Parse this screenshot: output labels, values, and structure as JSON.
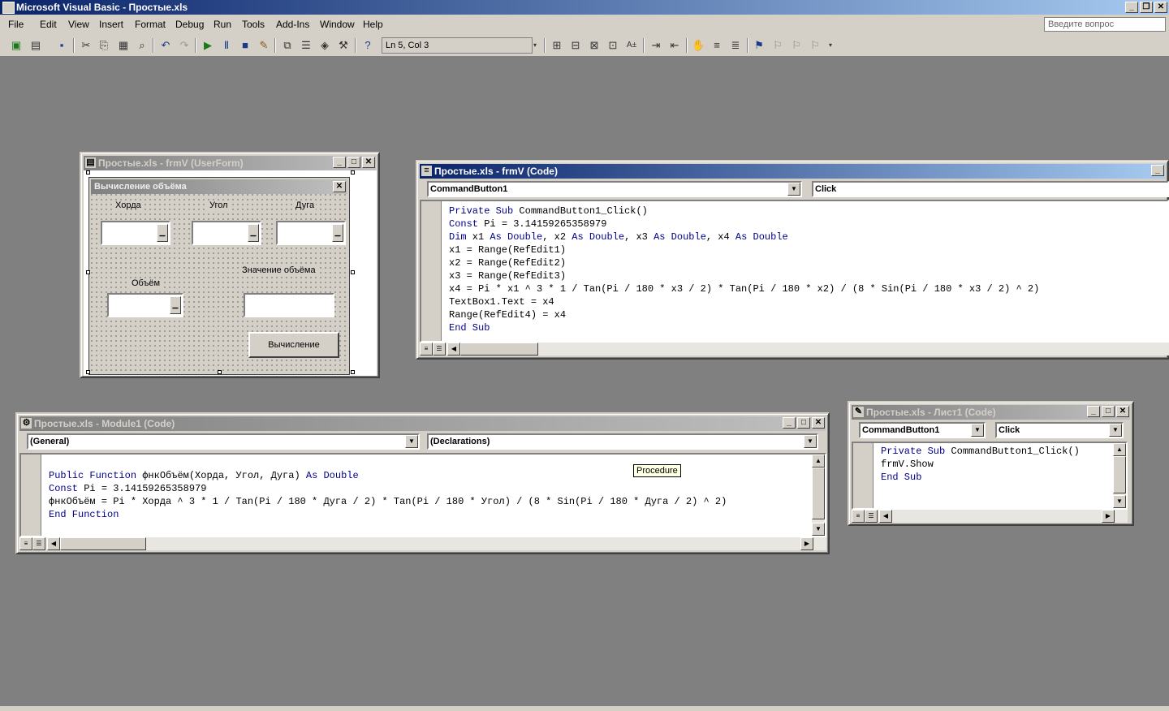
{
  "app": {
    "title": "Microsoft Visual Basic - Простые.xls",
    "help_placeholder": "Введите вопрос"
  },
  "menu": [
    "File",
    "Edit",
    "View",
    "Insert",
    "Format",
    "Debug",
    "Run",
    "Tools",
    "Add-Ins",
    "Window",
    "Help"
  ],
  "toolbar": {
    "position": "Ln 5, Col 3"
  },
  "userform_window": {
    "title": "Простые.xls - frmV (UserForm)",
    "form_caption": "Вычисление объёма",
    "labels": {
      "chord": "Хорда",
      "angle": "Угол",
      "arc": "Дуга",
      "volume": "Объём",
      "volume_value": "Значение объёма"
    },
    "button_label": "Вычисление"
  },
  "frmv_code_window": {
    "title": "Простые.xls - frmV (Code)",
    "object_combo": "CommandButton1",
    "proc_combo": "Click",
    "lines": [
      "Private Sub CommandButton1_Click()",
      "Const Pi = 3.14159265358979",
      "Dim x1 As Double, x2 As Double, x3 As Double, x4 As Double",
      "x1 = Range(RefEdit1)",
      "x2 = Range(RefEdit2)",
      "x3 = Range(RefEdit3)",
      "x4 = Pi * x1 ^ 3 * 1 / Tan(Pi / 180 * x3 / 2) * Tan(Pi / 180 * x2) / (8 * Sin(Pi / 180 * x3 / 2) ^ 2)",
      "TextBox1.Text = x4",
      "Range(RefEdit4) = x4",
      "End Sub"
    ]
  },
  "module_window": {
    "title": "Простые.xls - Module1 (Code)",
    "object_combo": "(General)",
    "proc_combo": "(Declarations)",
    "tooltip": "Procedure",
    "lines": [
      "Public Function фнкОбъём(Хорда, Угол, Дуга) As Double",
      "Const Pi = 3.14159265358979",
      "фнкОбъём = Pi * Хорда ^ 3 * 1 / Tan(Pi / 180 * Дуга / 2) * Tan(Pi / 180 * Угол) / (8 * Sin(Pi / 180 * Дуга / 2) ^ 2)",
      "End Function"
    ]
  },
  "sheet_window": {
    "title": "Простые.xls - Лист1 (Code)",
    "object_combo": "CommandButton1",
    "proc_combo": "Click",
    "lines": [
      "Private Sub CommandButton1_Click()",
      "frmV.Show",
      "End Sub"
    ]
  },
  "colors": {
    "title_active": "#0a246a",
    "keyword": "#00008b",
    "face": "#d4d0c8",
    "workspace": "#808080"
  }
}
